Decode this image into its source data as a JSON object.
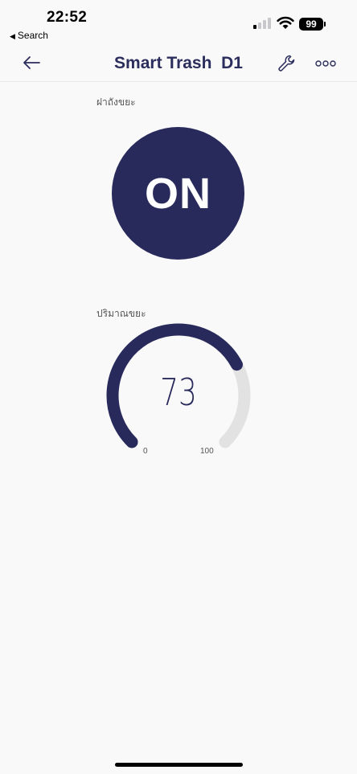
{
  "status": {
    "time": "22:52",
    "back_app": "Search",
    "battery": "99"
  },
  "header": {
    "title": "Smart Trash  D1"
  },
  "lid": {
    "label": "ฝาถังขยะ",
    "state": "ON"
  },
  "gauge": {
    "label": "ปริมาณขยะ",
    "value": 73,
    "value_text": "73",
    "min": "0",
    "max": "100"
  },
  "colors": {
    "accent": "#292a5c",
    "track": "#e2e2e2",
    "background": "#f9f9f9"
  },
  "icons": {
    "back": "arrow-left-icon",
    "settings": "wrench-icon",
    "more": "more-dots-icon"
  }
}
